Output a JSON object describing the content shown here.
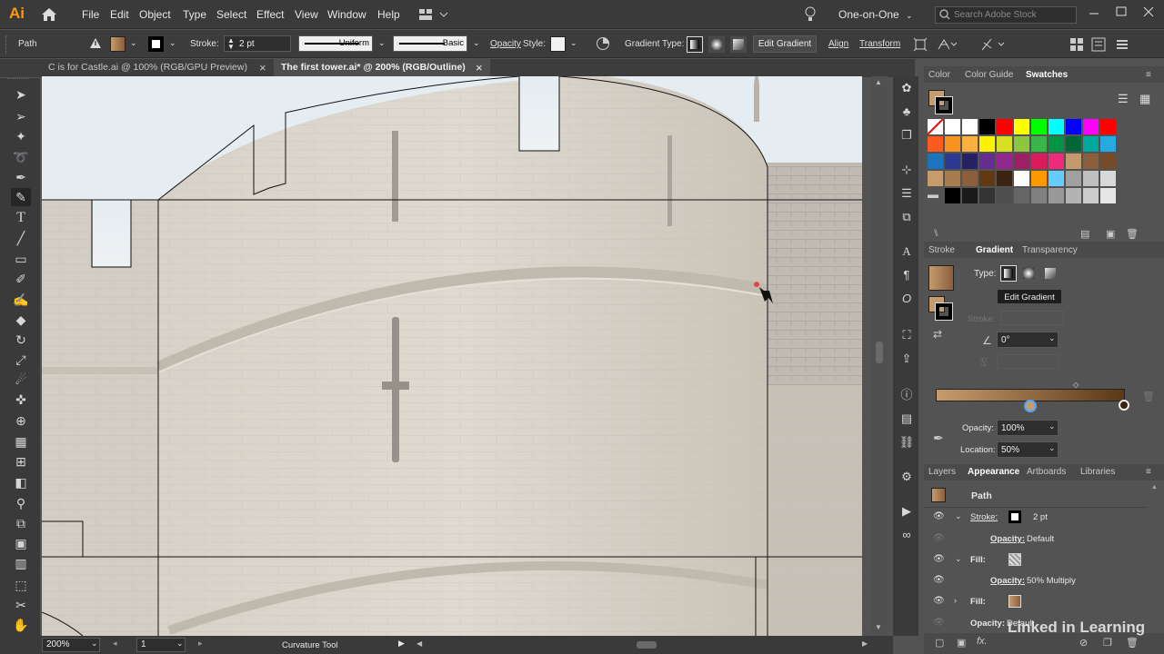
{
  "app": {
    "logo": "Ai"
  },
  "menu": [
    "File",
    "Edit",
    "Object",
    "Type",
    "Select",
    "Effect",
    "View",
    "Window",
    "Help"
  ],
  "header": {
    "workspace": "One-on-One",
    "search_placeholder": "Search Adobe Stock"
  },
  "control": {
    "selection": "Path",
    "stroke_label": "Stroke:",
    "stroke_weight": "2 pt",
    "profile": "Uniform",
    "brush": "Basic",
    "opacity_label": "Opacity",
    "style_label": "Style:",
    "gradient_type_label": "Gradient Type:",
    "edit_gradient": "Edit Gradient",
    "align": "Align",
    "transform": "Transform"
  },
  "tabs": [
    {
      "label": "C is for Castle.ai @ 100% (RGB/GPU Preview)",
      "close": "×"
    },
    {
      "label": "The first tower.ai* @ 200% (RGB/Outline)",
      "close": "×"
    }
  ],
  "swatches_panel": {
    "tabs": [
      "Color",
      "Color Guide",
      "Swatches"
    ],
    "rows": [
      [
        "none",
        "#ffffff",
        "#ffffff",
        "#000000",
        "#ff0000",
        "#ffff00",
        "#00ff00",
        "#00ffff",
        "#0000ff",
        "#ff00ff",
        "#ff0000"
      ],
      [
        "#ff5a1f",
        "#f7941d",
        "#fbb040",
        "#fff200",
        "#d7df23",
        "#8dc63f",
        "#39b54a",
        "#009444",
        "#006838",
        "#00a79d",
        "#27aae1"
      ],
      [
        "#1c75bc",
        "#2b3990",
        "#262262",
        "#662d91",
        "#92278f",
        "#9e1f63",
        "#da1c5c",
        "#ee2a7b",
        "#c49a6c",
        "#8b5e3c",
        "#754c29"
      ],
      [
        "#c69c6d",
        "#a97c50",
        "#8b5e3c",
        "#603913",
        "#3c2415",
        "#ffffff",
        "#ff9900",
        "#66ccff",
        "#a0a0a0",
        "#bfbfbf",
        "#d9d9d9"
      ],
      [
        "folder",
        "#000000",
        "#1a1a1a",
        "#333333",
        "#4d4d4d",
        "#666666",
        "#808080",
        "#999999",
        "#b3b3b3",
        "#cccccc",
        "#e6e6e6"
      ]
    ]
  },
  "gradient_panel": {
    "tabs": [
      "Stroke",
      "Gradient",
      "Transparency"
    ],
    "type_label": "Type:",
    "tooltip": "Edit Gradient",
    "stroke_label": "Stroke:",
    "angle": "0°",
    "opacity_label": "Opacity:",
    "opacity": "100%",
    "location_label": "Location:",
    "location": "50%",
    "start_color": "#c69c6d",
    "end_color": "#5a3818"
  },
  "appearance_panel": {
    "tabs": [
      "Layers",
      "Appearance",
      "Artboards",
      "Libraries"
    ],
    "object": "Path",
    "rows": [
      {
        "label": "Stroke:",
        "value": "2 pt"
      },
      {
        "label": "Opacity:",
        "value": "Default"
      },
      {
        "label": "Fill:",
        "value": ""
      },
      {
        "label": "Opacity:",
        "value": "50% Multiply"
      },
      {
        "label": "Fill:",
        "value": ""
      },
      {
        "label": "Opacity:",
        "value": "Default"
      }
    ]
  },
  "status": {
    "zoom": "200%",
    "artboard": "1",
    "tool": "Curvature Tool"
  },
  "watermark": "Linked in Learning"
}
